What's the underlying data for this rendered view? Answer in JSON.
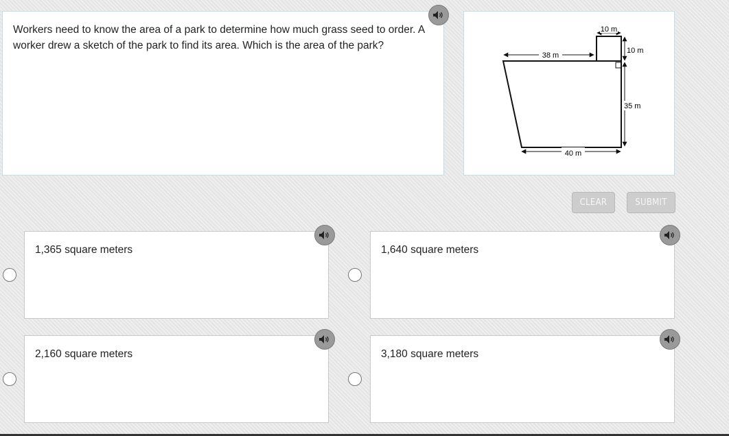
{
  "question": {
    "text": "Workers need to know the area of a park to determine how much grass seed to order. A worker drew a sketch of the park to find its area. Which is the area of the park?"
  },
  "figure": {
    "labels": {
      "top_square_width": "10 m",
      "top_square_height": "10 m",
      "top_length": "38 m",
      "right_height": "35 m",
      "bottom_length": "40 m"
    }
  },
  "buttons": {
    "clear": "CLEAR",
    "submit": "SUBMIT"
  },
  "options": [
    {
      "label": "1,365 square meters"
    },
    {
      "label": "1,640 square meters"
    },
    {
      "label": "2,160 square meters"
    },
    {
      "label": "3,180 square meters"
    }
  ],
  "icons": {
    "audio": "speaker-icon",
    "selection": "radio-button"
  }
}
